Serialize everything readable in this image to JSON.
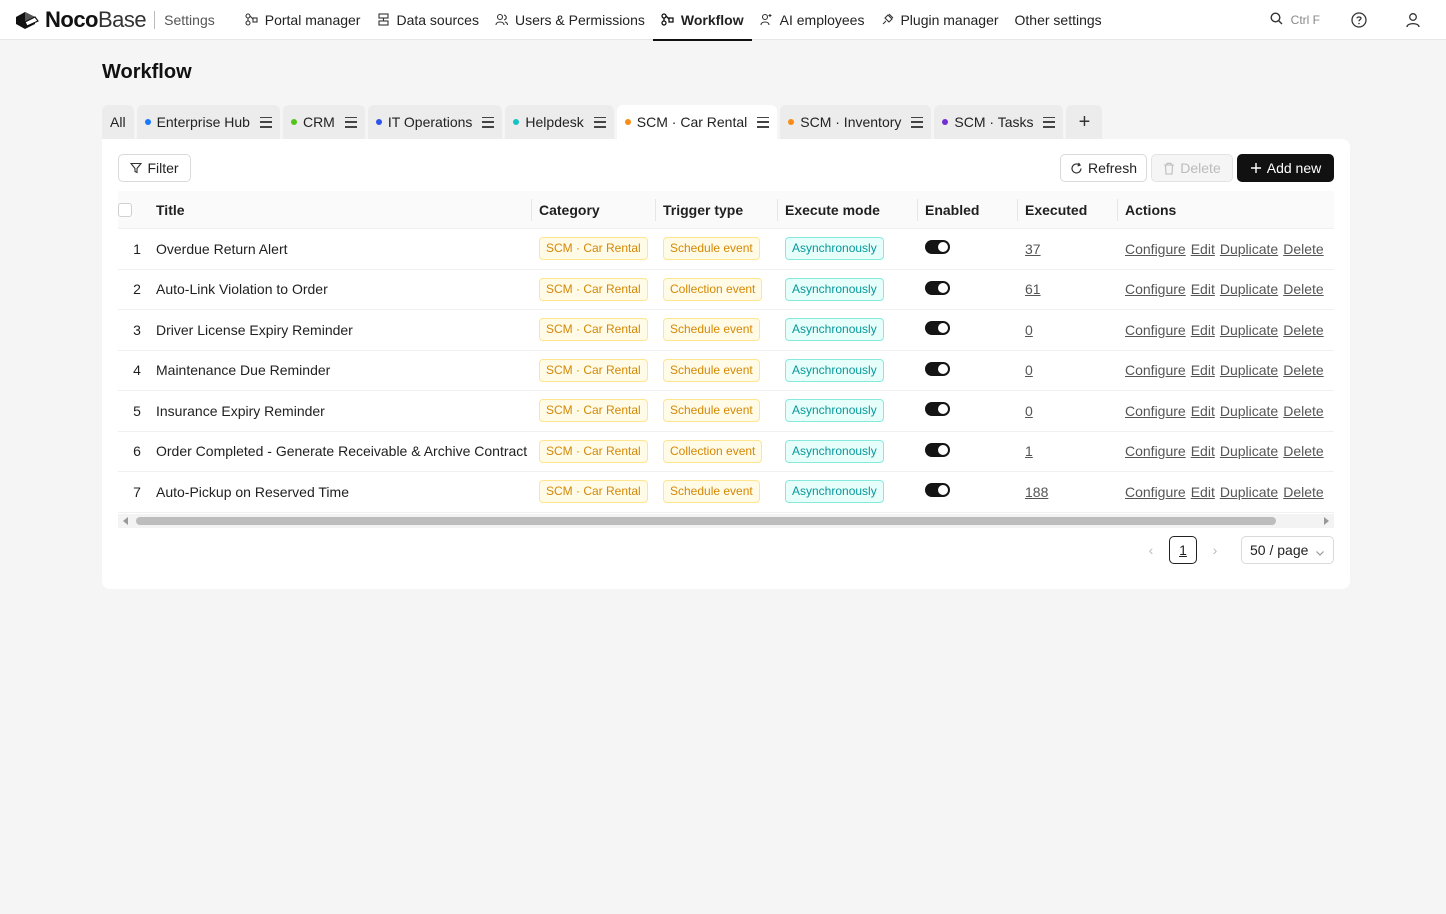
{
  "app": {
    "brand_bold": "Noco",
    "brand_light": "Base",
    "section": "Settings"
  },
  "nav": {
    "items": [
      {
        "label": "Portal manager",
        "icon": "portal-icon"
      },
      {
        "label": "Data sources",
        "icon": "database-icon"
      },
      {
        "label": "Users & Permissions",
        "icon": "users-icon"
      },
      {
        "label": "Workflow",
        "icon": "workflow-icon",
        "active": true
      },
      {
        "label": "AI employees",
        "icon": "ai-icon"
      },
      {
        "label": "Plugin manager",
        "icon": "plugin-icon"
      },
      {
        "label": "Other settings",
        "icon": ""
      }
    ],
    "search_hint": "Ctrl F"
  },
  "page": {
    "title": "Workflow"
  },
  "tabs": [
    {
      "label": "All",
      "color": "",
      "menu": false
    },
    {
      "label": "Enterprise Hub",
      "color": "#1677ff",
      "menu": true
    },
    {
      "label": "CRM",
      "color": "#52c41a",
      "menu": true
    },
    {
      "label": "IT Operations",
      "color": "#2f54eb",
      "menu": true
    },
    {
      "label": "Helpdesk",
      "color": "#13c2c2",
      "menu": true
    },
    {
      "label": "SCM · Car Rental",
      "color": "#fa8c16",
      "menu": true,
      "active": true
    },
    {
      "label": "SCM · Inventory",
      "color": "#fa8c16",
      "menu": true
    },
    {
      "label": "SCM · Tasks",
      "color": "#722ed1",
      "menu": true
    }
  ],
  "toolbar": {
    "filter_label": "Filter",
    "refresh_label": "Refresh",
    "delete_label": "Delete",
    "add_label": "Add new"
  },
  "table": {
    "columns": {
      "title": "Title",
      "category": "Category",
      "trigger": "Trigger type",
      "mode": "Execute mode",
      "enabled": "Enabled",
      "executed": "Executed",
      "actions": "Actions"
    },
    "action_labels": [
      "Configure",
      "Edit",
      "Duplicate",
      "Delete"
    ],
    "rows": [
      {
        "index": "1",
        "title": "Overdue Return Alert",
        "category": "SCM · Car Rental",
        "trigger": "Schedule event",
        "mode": "Asynchronously",
        "enabled": true,
        "executed": "37"
      },
      {
        "index": "2",
        "title": "Auto-Link Violation to Order",
        "category": "SCM · Car Rental",
        "trigger": "Collection event",
        "mode": "Asynchronously",
        "enabled": true,
        "executed": "61"
      },
      {
        "index": "3",
        "title": "Driver License Expiry Reminder",
        "category": "SCM · Car Rental",
        "trigger": "Schedule event",
        "mode": "Asynchronously",
        "enabled": true,
        "executed": "0"
      },
      {
        "index": "4",
        "title": "Maintenance Due Reminder",
        "category": "SCM · Car Rental",
        "trigger": "Schedule event",
        "mode": "Asynchronously",
        "enabled": true,
        "executed": "0"
      },
      {
        "index": "5",
        "title": "Insurance Expiry Reminder",
        "category": "SCM · Car Rental",
        "trigger": "Schedule event",
        "mode": "Asynchronously",
        "enabled": true,
        "executed": "0"
      },
      {
        "index": "6",
        "title": "Order Completed - Generate Receivable & Archive Contract",
        "category": "SCM · Car Rental",
        "trigger": "Collection event",
        "mode": "Asynchronously",
        "enabled": true,
        "executed": "1"
      },
      {
        "index": "7",
        "title": "Auto-Pickup on Reserved Time",
        "category": "SCM · Car Rental",
        "trigger": "Schedule event",
        "mode": "Asynchronously",
        "enabled": true,
        "executed": "188"
      }
    ]
  },
  "pagination": {
    "current_page": "1",
    "page_size": "50 / page"
  }
}
